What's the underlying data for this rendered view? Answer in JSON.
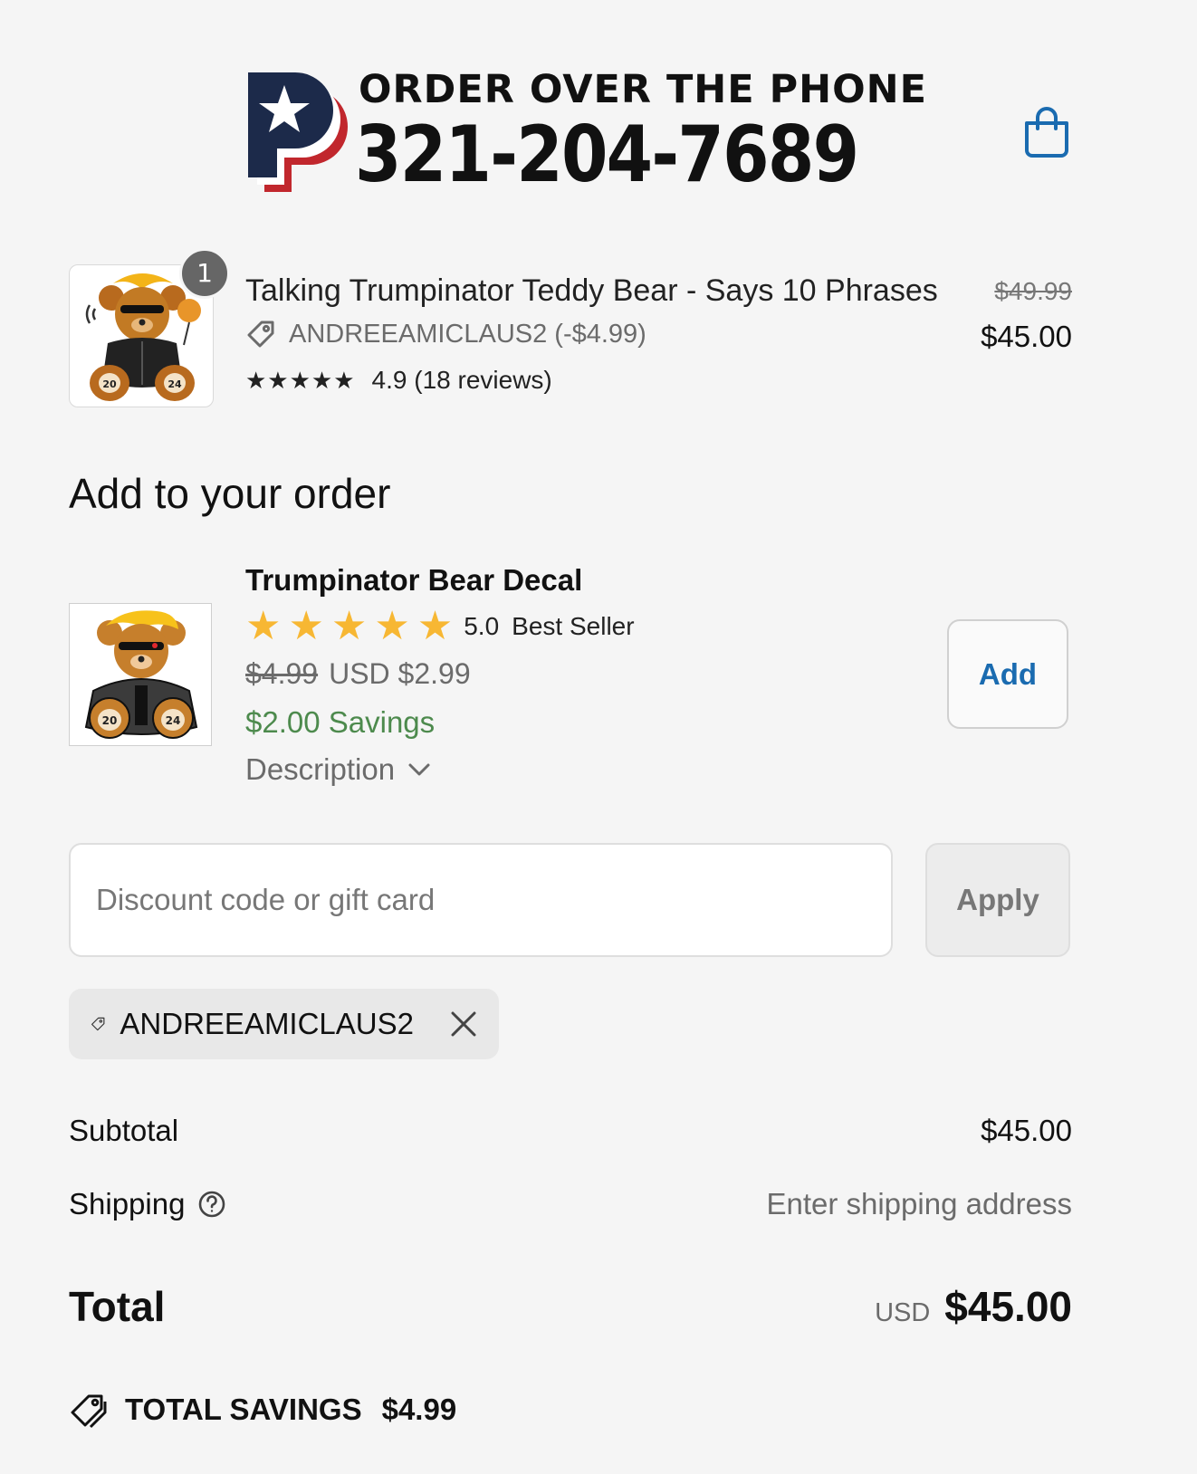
{
  "header": {
    "logo_line1": "ORDER OVER THE PHONE",
    "logo_line2": "321-204-7689",
    "cart_icon": "shopping-bag-icon",
    "brand_colors": {
      "navy": "#1c2a4a",
      "red": "#c1272d",
      "accent": "#1a6bb0"
    }
  },
  "line_item": {
    "quantity": "1",
    "title": "Talking Trumpinator Teddy Bear - Says 10 Phrases",
    "discount": "ANDREEAMICLAUS2 (-$4.99)",
    "stars": "★★★★★",
    "rating_text": "4.9 (18 reviews)",
    "original_price": "$49.99",
    "price": "$45.00"
  },
  "upsell": {
    "section_title": "Add to your order",
    "name": "Trumpinator Bear Decal",
    "stars": "★★★★★",
    "rating": "5.0",
    "best_seller": "Best Seller",
    "original_price": "$4.99",
    "price": "USD $2.99",
    "savings": "$2.00 Savings",
    "description_label": "Description",
    "add_label": "Add",
    "savings_color": "#4d8a4d"
  },
  "discount": {
    "placeholder": "Discount code or gift card",
    "apply_label": "Apply",
    "applied_code": "ANDREEAMICLAUS2"
  },
  "summary": {
    "subtotal_label": "Subtotal",
    "subtotal_value": "$45.00",
    "shipping_label": "Shipping",
    "shipping_value": "Enter shipping address",
    "total_label": "Total",
    "total_currency": "USD",
    "total_value": "$45.00",
    "savings_label": "TOTAL SAVINGS",
    "savings_value": "$4.99"
  }
}
